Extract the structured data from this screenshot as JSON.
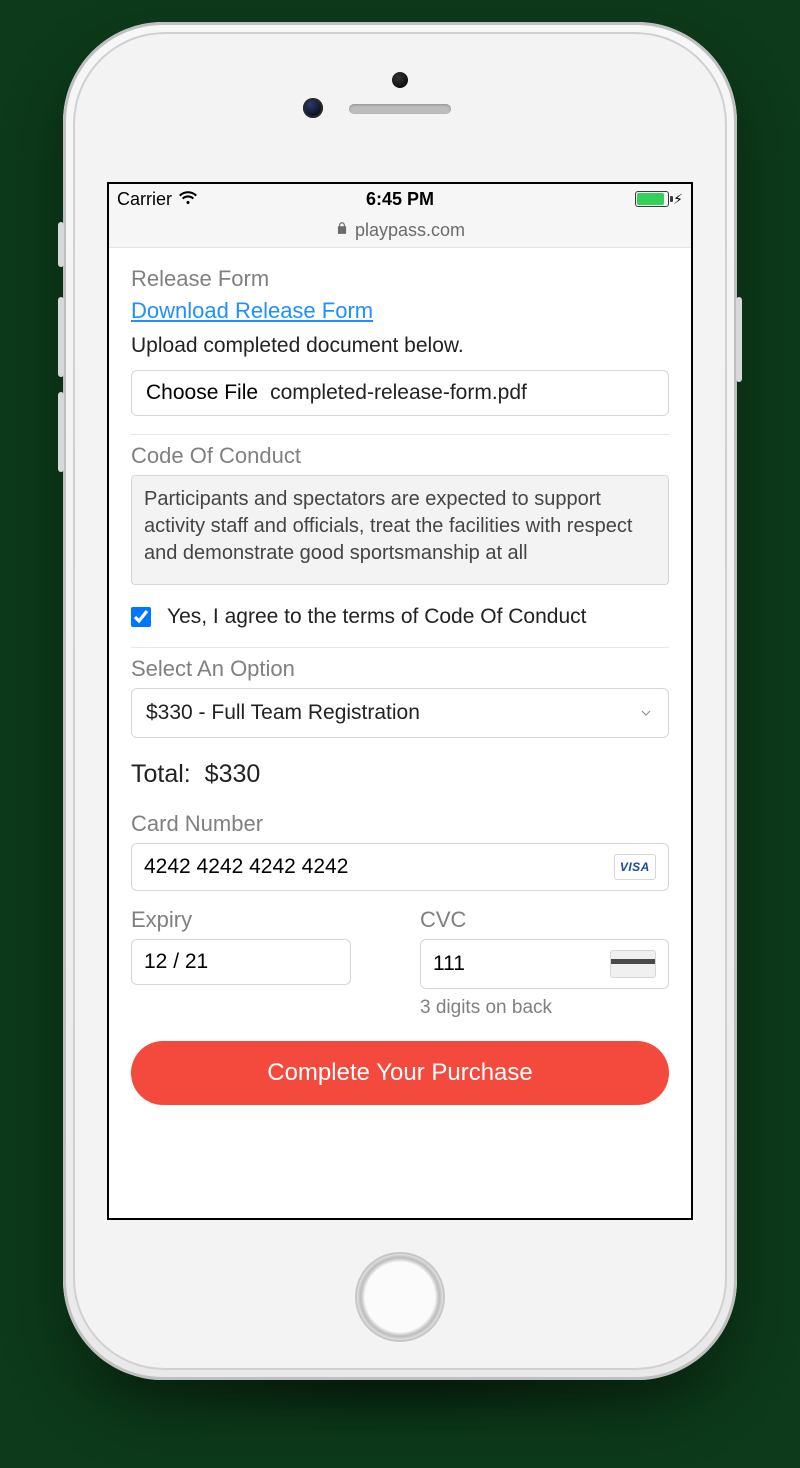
{
  "status": {
    "carrier": "Carrier",
    "time": "6:45 PM",
    "domain": "playpass.com"
  },
  "release": {
    "title": "Release Form",
    "download_link": "Download Release Form",
    "instruction": "Upload completed document below.",
    "choose_label": "Choose File",
    "filename": "completed-release-form.pdf"
  },
  "conduct": {
    "title": "Code Of Conduct",
    "text": "Participants and spectators are expected to support activity staff and officials, treat the facilities with respect and demonstrate good sportsmanship at all",
    "agree_label": "Yes, I agree to the terms of Code Of Conduct",
    "agreed": true
  },
  "option": {
    "title": "Select An Option",
    "selected": "$330 - Full Team Registration"
  },
  "total": {
    "label": "Total:",
    "amount": "$330"
  },
  "payment": {
    "card_label": "Card Number",
    "card_value": "4242 4242 4242 4242",
    "card_brand": "VISA",
    "expiry_label": "Expiry",
    "expiry_value": "12 / 21",
    "cvc_label": "CVC",
    "cvc_value": "111",
    "cvc_help": "3 digits on back"
  },
  "cta_label": "Complete Your Purchase"
}
